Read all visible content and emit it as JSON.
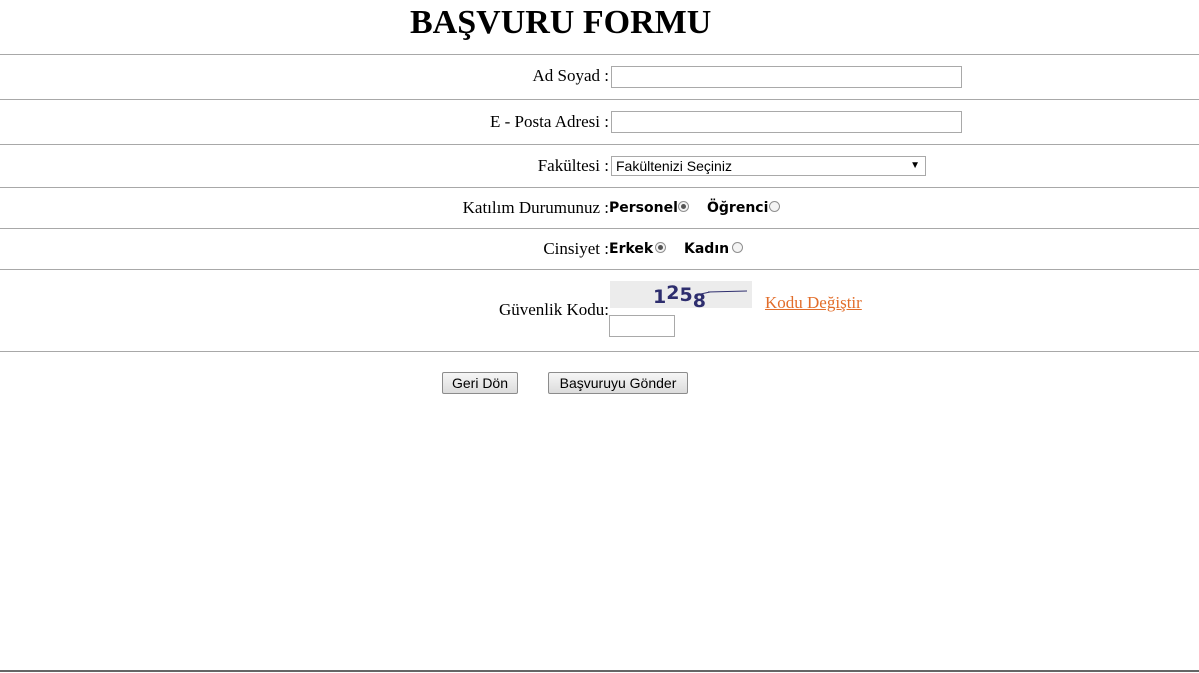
{
  "form": {
    "title": "BAŞVURU FORMU"
  },
  "fields": {
    "name": {
      "label": "Ad Soyad :",
      "value": ""
    },
    "email": {
      "label": "E - Posta Adresi :",
      "value": ""
    },
    "faculty": {
      "label": "Fakültesi :",
      "selected": "Fakültenizi Seçiniz"
    },
    "participation": {
      "label": "Katılım Durumunuz :",
      "options": [
        {
          "label": "Personel",
          "checked": true
        },
        {
          "label": "Öğrenci",
          "checked": false
        }
      ]
    },
    "gender": {
      "label": "Cinsiyet :",
      "options": [
        {
          "label": "Erkek",
          "checked": true
        },
        {
          "label": "Kadın",
          "checked": false
        }
      ]
    },
    "captcha": {
      "label": "Güvenlik Kodu:",
      "code": "1258",
      "change_link": "Kodu Değiştir",
      "value": ""
    }
  },
  "buttons": {
    "back": "Geri Dön",
    "submit": "Başvuruyu Gönder"
  },
  "colors": {
    "link": "#e26d2a",
    "captcha_text": "#2e2e6e",
    "divider": "#a8a8a8"
  }
}
